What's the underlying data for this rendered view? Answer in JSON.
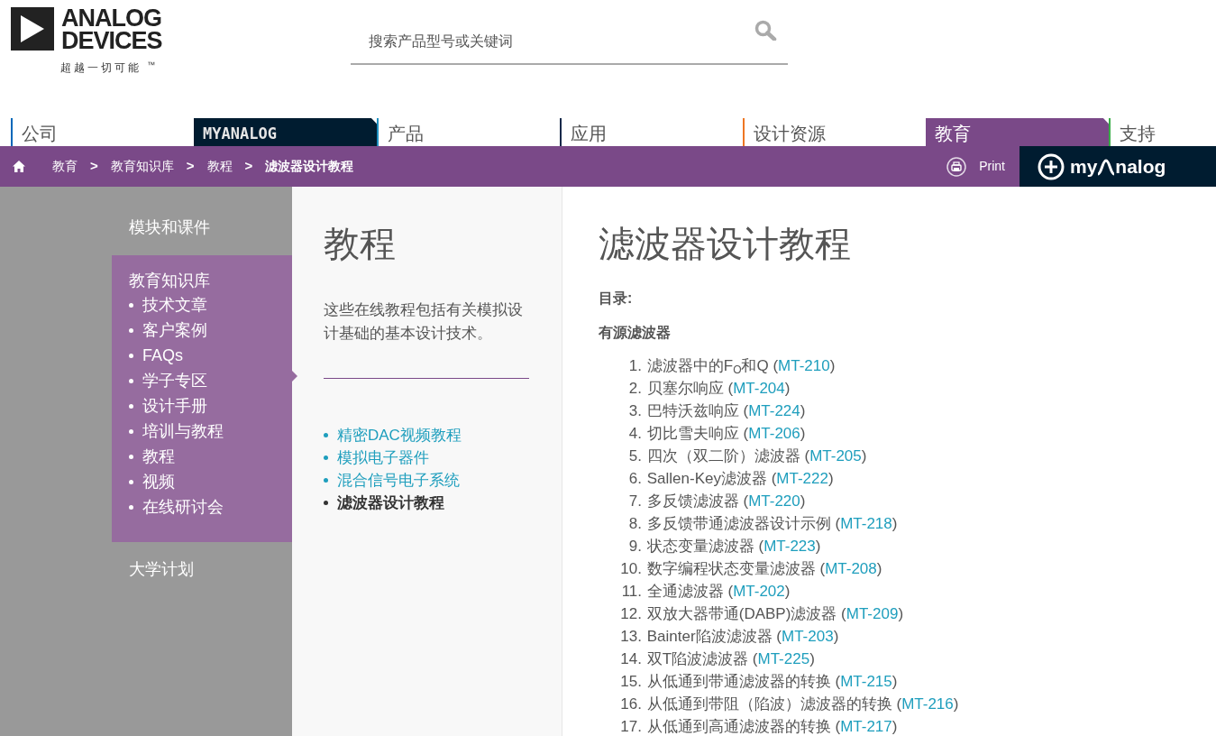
{
  "logo": {
    "lines": [
      "ANALOG",
      "DEVICES"
    ],
    "tagline": "超越一切可能",
    "trademark": "™"
  },
  "search": {
    "placeholder": "搜索产品型号或关键词"
  },
  "nav_tabs": [
    {
      "label": "公司",
      "kind": "plain",
      "color": "#0067b9",
      "selected": false
    },
    {
      "label": "MYANALOG",
      "kind": "dark",
      "color": "#001c30",
      "selected": false
    },
    {
      "label": "产品",
      "kind": "plain",
      "color": "#1e90c0",
      "selected": false
    },
    {
      "label": "应用",
      "kind": "plain",
      "color": "#15294a",
      "selected": false
    },
    {
      "label": "设计资源",
      "kind": "plain",
      "color": "#ee7623",
      "selected": false
    },
    {
      "label": "教育",
      "kind": "plain",
      "color": "#7a4988",
      "selected": true
    },
    {
      "label": "支持",
      "kind": "plain",
      "color": "#3aae49",
      "selected": false
    }
  ],
  "breadcrumb": {
    "separator": ">",
    "items": [
      {
        "label": "教育",
        "selected": false
      },
      {
        "label": "教育知识库",
        "selected": false
      },
      {
        "label": "教程",
        "selected": false
      },
      {
        "label": "滤波器设计教程",
        "selected": true
      }
    ]
  },
  "print_button": {
    "label": "Print"
  },
  "myanalog_button": {
    "prefix": "my",
    "suffix": "nalog"
  },
  "sidebar": {
    "items": [
      {
        "label": "模块和课件",
        "expanded": false
      },
      {
        "label": "教育知识库",
        "expanded": true,
        "children": [
          {
            "label": "技术文章"
          },
          {
            "label": "客户案例"
          },
          {
            "label": "FAQs"
          },
          {
            "label": "学子专区"
          },
          {
            "label": "设计手册"
          },
          {
            "label": "培训与教程"
          },
          {
            "label": "教程"
          },
          {
            "label": "视频"
          },
          {
            "label": "在线研讨会"
          }
        ]
      },
      {
        "label": "大学计划",
        "expanded": false
      }
    ]
  },
  "section": {
    "title": "教程",
    "description": "这些在线教程包括有关模拟设计基础的基本设计技术。",
    "links": [
      {
        "label": "精密DAC视频教程",
        "selected": false
      },
      {
        "label": "模拟电子器件",
        "selected": false
      },
      {
        "label": "混合信号电子系统",
        "selected": false
      },
      {
        "label": "滤波器设计教程",
        "selected": true
      }
    ]
  },
  "article": {
    "title": "滤波器设计教程",
    "brackets": [
      "(",
      ")"
    ],
    "toc_label": "目录:",
    "group_title": "有源滤波器",
    "items": [
      {
        "number": "1.",
        "title": "滤波器中的F$_{O}$和Q",
        "code": "MT-210"
      },
      {
        "number": "2.",
        "title": "贝塞尔响应",
        "code": "MT-204"
      },
      {
        "number": "3.",
        "title": "巴特沃兹响应",
        "code": "MT-224"
      },
      {
        "number": "4.",
        "title": "切比雪夫响应",
        "code": "MT-206"
      },
      {
        "number": "5.",
        "title": "四次（双二阶）滤波器",
        "code": "MT-205"
      },
      {
        "number": "6.",
        "title": "Sallen-Key滤波器",
        "code": "MT-222"
      },
      {
        "number": "7.",
        "title": "多反馈滤波器",
        "code": "MT-220"
      },
      {
        "number": "8.",
        "title": "多反馈带通滤波器设计示例",
        "code": "MT-218"
      },
      {
        "number": "9.",
        "title": "状态变量滤波器",
        "code": "MT-223"
      },
      {
        "number": "10.",
        "title": "数字编程状态变量滤波器",
        "code": "MT-208"
      },
      {
        "number": "11.",
        "title": "全通滤波器",
        "code": "MT-202"
      },
      {
        "number": "12.",
        "title": "双放大器带通(DABP)滤波器",
        "code": "MT-209"
      },
      {
        "number": "13.",
        "title": "Bainter陷波滤波器",
        "code": "MT-203"
      },
      {
        "number": "14.",
        "title": "双T陷波滤波器",
        "code": "MT-225"
      },
      {
        "number": "15.",
        "title": "从低通到带通滤波器的转换",
        "code": "MT-215"
      },
      {
        "number": "16.",
        "title": "从低通到带阻（陷波）滤波器的转换",
        "code": "MT-216"
      },
      {
        "number": "17.",
        "title": "从低通到高通滤波器的转换",
        "code": "MT-217"
      }
    ]
  }
}
